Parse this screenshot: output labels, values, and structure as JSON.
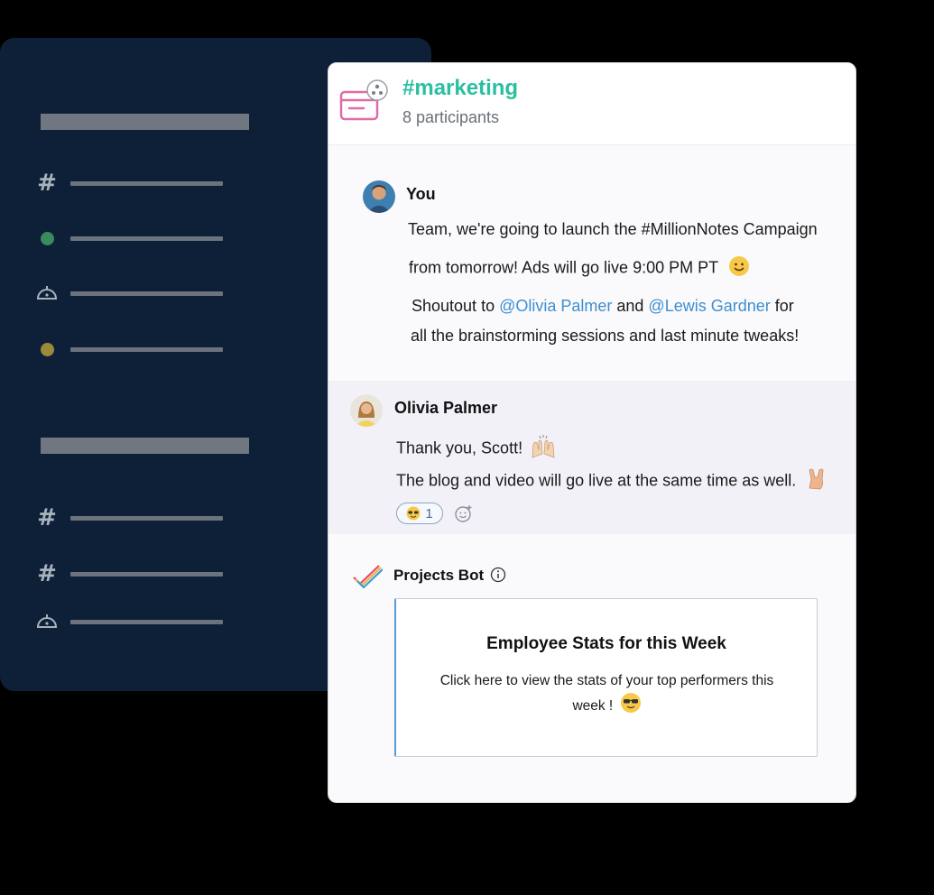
{
  "sidebar": {
    "rows": [
      {
        "icon": "hash-icon",
        "glyph": "#"
      },
      {
        "icon": "green-status-dot-icon",
        "color": "#3a8a5f"
      },
      {
        "icon": "bot-icon"
      },
      {
        "icon": "yellow-status-dot-icon",
        "color": "#9a8a3a"
      },
      {
        "icon": "hash-icon",
        "glyph": "#"
      },
      {
        "icon": "hash-icon",
        "glyph": "#"
      },
      {
        "icon": "bot-icon"
      }
    ]
  },
  "channel": {
    "name": "#marketing",
    "participants": "8 participants"
  },
  "messages": {
    "you": {
      "author": "You",
      "line1": "Team, we're going to launch the #MillionNotes Campaign",
      "line2": "from tomorrow!  Ads will go live 9:00 PM PT",
      "line3_pre": "Shoutout to ",
      "mention1": "@Olivia Palmer",
      "line3_mid": " and ",
      "mention2": "@Lewis Gardner",
      "line3_post": " for",
      "line4": "all the  brainstorming sessions and last minute tweaks!"
    },
    "olivia": {
      "author": "Olivia  Palmer",
      "line1": "Thank you, Scott!",
      "line2": "The blog and video will go live at the same time as well.",
      "reaction_count": "1"
    },
    "bot": {
      "author": "Projects Bot",
      "card_title": "Employee Stats for this Week",
      "card_body": "Click here to view the stats of your top performers this week !"
    }
  },
  "colors": {
    "accent": "#2bbfa0",
    "mention": "#3e8ecf",
    "sidebar_bg": "#0d2038"
  }
}
